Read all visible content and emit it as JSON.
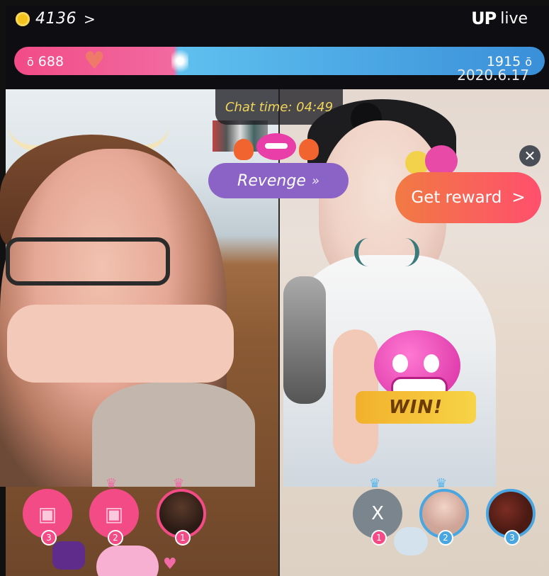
{
  "header": {
    "coins": "4136",
    "coin_arrow": ">",
    "logo_mark": "UP",
    "logo_text": "live"
  },
  "pk_score": {
    "left": "688",
    "right": "1915",
    "icon": "ō"
  },
  "watermark_date": "2020.6.17",
  "overlay": {
    "chat_time": "Chat time: 04:49",
    "revenge_label": "Revenge",
    "revenge_arrows": "»",
    "reward_label": "Get reward",
    "reward_arrow": ">",
    "close_symbol": "✕",
    "win_text": "WIN!"
  },
  "seats": {
    "left": [
      {
        "rank": "3"
      },
      {
        "rank": "2"
      },
      {
        "rank": "1"
      }
    ],
    "right": [
      {
        "rank": "1",
        "label": "X"
      },
      {
        "rank": "2"
      },
      {
        "rank": "3"
      }
    ]
  },
  "colors": {
    "pink": "#f24b86",
    "blue": "#4aa6e0",
    "purple": "#8b63c7",
    "orange": "#f17a43"
  }
}
